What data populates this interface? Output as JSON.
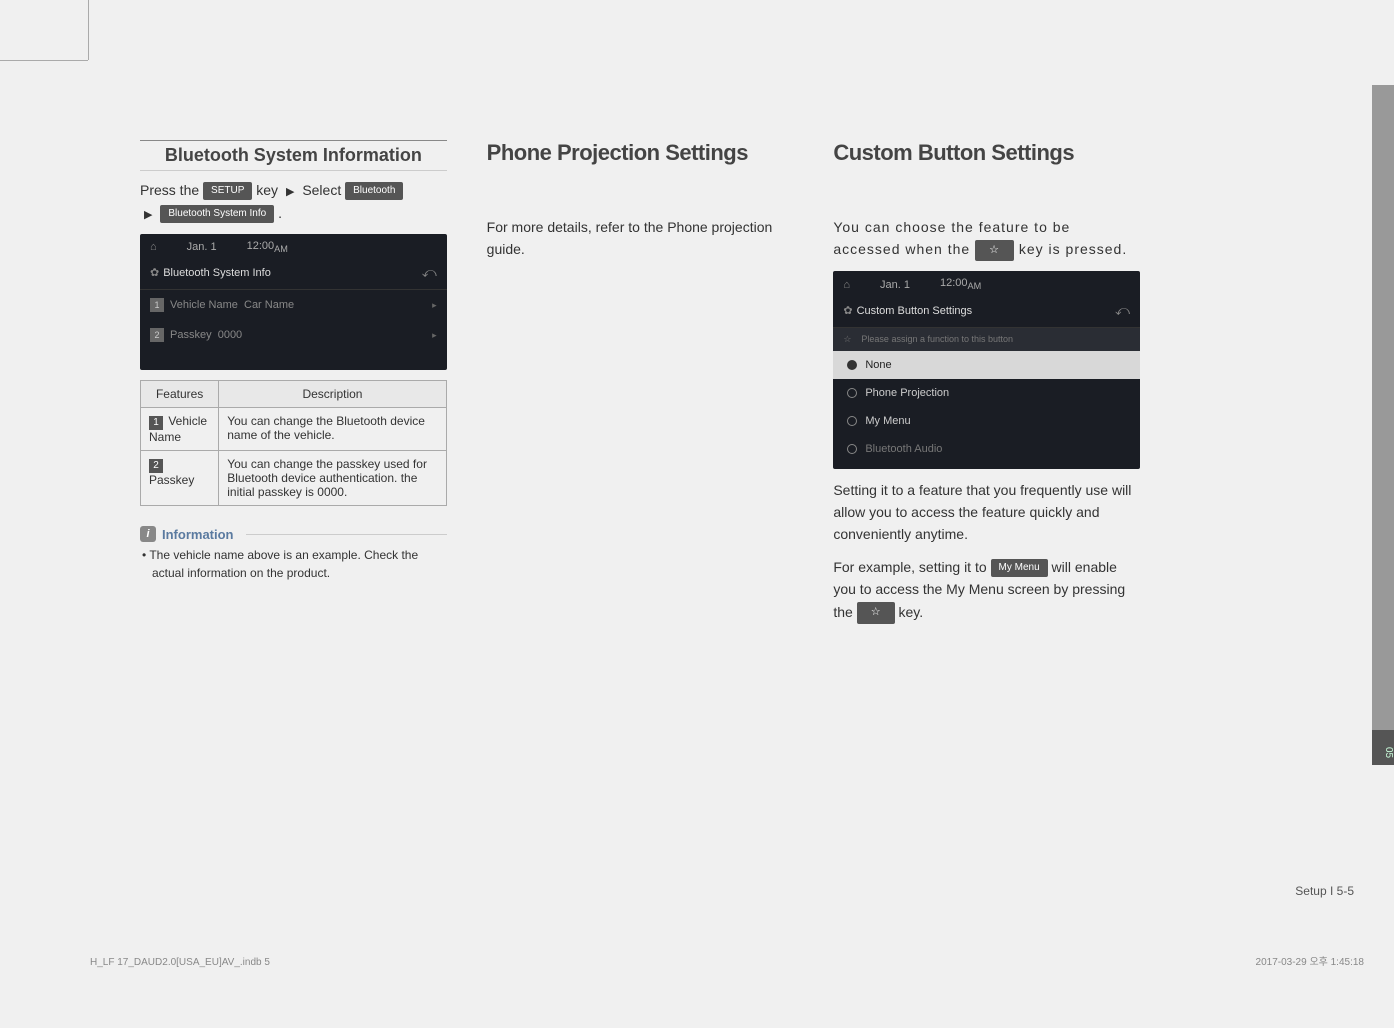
{
  "side_tab_label": "05",
  "col1": {
    "sub_title": "Bluetooth System Information",
    "press_prefix": "Press the ",
    "setup_btn": "SETUP",
    "key_text": " key ",
    "select_text": " Select ",
    "bluetooth_btn": "Bluetooth",
    "bt_info_btn": "Bluetooth System Info",
    "period": ".",
    "screenshot": {
      "date": "Jan. 1",
      "time": "12:00",
      "ampm": "AM",
      "title": "Bluetooth System Info",
      "row1_label": "Vehicle Name",
      "row1_value": "Car Name",
      "row2_label": "Passkey",
      "row2_value": "0000"
    },
    "table": {
      "h1": "Features",
      "h2": "Description",
      "r1_feat": " Vehicle Name",
      "r1_desc": "You can change the Bluetooth device name of the vehicle.",
      "r2_feat": " Passkey",
      "r2_desc": "You can change the passkey used for Bluetooth device authentication. the initial passkey is 0000."
    },
    "info_label": "Information",
    "info_bullet": "•  The vehicle name above is an example. Check the actual information on the product."
  },
  "col2": {
    "title": "Phone Projection Settings",
    "body": "For more details, refer to the Phone projection guide."
  },
  "col3": {
    "title": "Custom Button Settings",
    "body1_a": "You can choose the feature to be accessed when the ",
    "body1_b": " key is pressed.",
    "screenshot": {
      "date": "Jan. 1",
      "time": "12:00",
      "ampm": "AM",
      "title": "Custom Button Settings",
      "prompt": "Please assign a function to this button",
      "opt1": "None",
      "opt2": "Phone Projection",
      "opt3": "My Menu",
      "opt4": "Bluetooth Audio"
    },
    "body2": "Setting it to a feature that you frequently use will allow you to access the feature quickly and conveniently anytime.",
    "body3_a": "For example, setting it to ",
    "mymenu_btn": "My Menu",
    "body3_b": " will enable you to access the My Menu screen by pressing the ",
    "body3_c": " key."
  },
  "footer": {
    "page_ref": "Setup I 5-5",
    "file_info": "H_LF 17_DAUD2.0[USA_EU]AV_.indb   5",
    "timestamp": "2017-03-29   오후 1:45:18"
  }
}
